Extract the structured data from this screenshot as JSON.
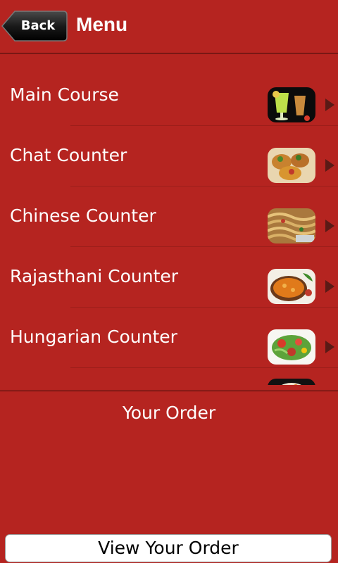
{
  "header": {
    "back_label": "Back",
    "title": "Menu"
  },
  "menu": {
    "items": [
      {
        "label": "Main Course",
        "icon": "drinks-icon"
      },
      {
        "label": "Chat Counter",
        "icon": "chaat-dish-icon"
      },
      {
        "label": "Chinese Counter",
        "icon": "noodles-icon"
      },
      {
        "label": "Rajasthani Counter",
        "icon": "curry-icon"
      },
      {
        "label": "Hungarian Counter",
        "icon": "salad-icon"
      }
    ]
  },
  "order": {
    "title": "Your Order",
    "view_label": "View Your Order"
  },
  "colors": {
    "background": "#b52420",
    "text": "#ffffff",
    "button_bg": "#ffffff",
    "button_text": "#000000"
  }
}
